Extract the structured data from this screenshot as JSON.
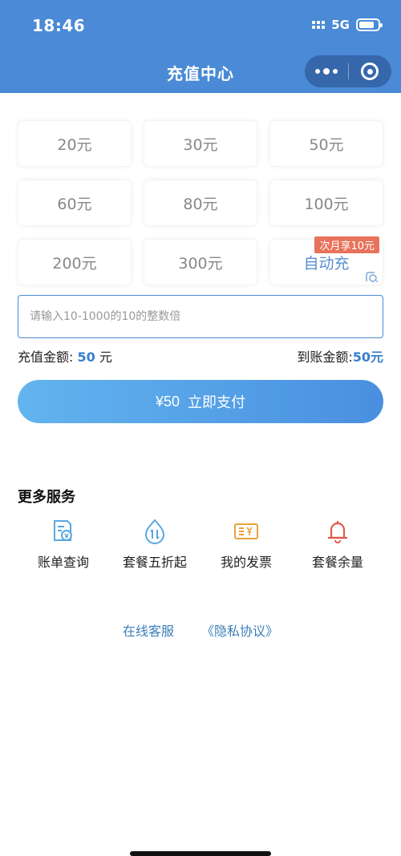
{
  "status_bar": {
    "time": "18:46",
    "network": "5G",
    "battery_level": 0.8
  },
  "header": {
    "title": "充值中心"
  },
  "amount_options": [
    {
      "label": "20元"
    },
    {
      "label": "30元"
    },
    {
      "label": "50元"
    },
    {
      "label": "60元"
    },
    {
      "label": "80元"
    },
    {
      "label": "100元"
    },
    {
      "label": "200元"
    },
    {
      "label": "300元"
    },
    {
      "label": "自动充",
      "badge": "次月享10元"
    }
  ],
  "input": {
    "placeholder": "请输入10-1000的10的整数倍",
    "value": ""
  },
  "summary": {
    "recharge_label": "充值金额: ",
    "recharge_value": "50",
    "recharge_unit": "元",
    "arrival_label": "到账金额:",
    "arrival_value": "50元"
  },
  "pay_button": {
    "price": "¥50",
    "label": "立即支付"
  },
  "more_services": {
    "title": "更多服务",
    "items": [
      {
        "label": "账单查询",
        "icon": "bill-query-icon",
        "color": "#5aa7e0"
      },
      {
        "label": "套餐五折起",
        "icon": "plan-discount-icon",
        "color": "#5aa7e0"
      },
      {
        "label": "我的发票",
        "icon": "invoice-icon",
        "color": "#e8a23a"
      },
      {
        "label": "套餐余量",
        "icon": "bell-icon",
        "color": "#e05a4a"
      }
    ]
  },
  "footer": {
    "service_link": "在线客服",
    "privacy_link": "《隐私协议》"
  },
  "colors": {
    "header": "#4a8ad6",
    "accent": "#3a7fcf",
    "badge": "#e8725b"
  }
}
